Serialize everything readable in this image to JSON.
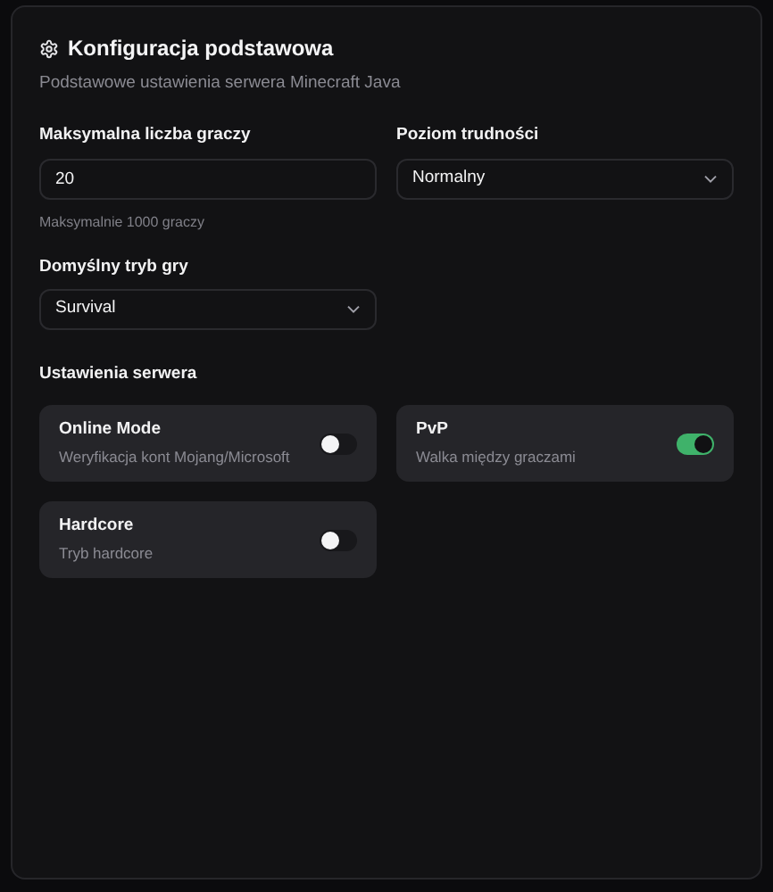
{
  "header": {
    "title": "Konfiguracja podstawowa",
    "subtitle": "Podstawowe ustawienia serwera Minecraft Java"
  },
  "fields": [
    {
      "kind": "input",
      "label": "Maksymalna liczba graczy",
      "value": "20",
      "help": "Maksymalnie 1000 graczy"
    },
    {
      "kind": "select",
      "label": "Poziom trudności",
      "value": "Normalny"
    },
    {
      "kind": "select",
      "label": "Domyślny tryb gry",
      "value": "Survival"
    }
  ],
  "server_settings": {
    "title": "Ustawienia serwera",
    "toggles": [
      {
        "label": "Online Mode",
        "description": "Weryfikacja kont Mojang/Microsoft",
        "on": false
      },
      {
        "label": "PvP",
        "description": "Walka między graczami",
        "on": true
      },
      {
        "label": "Hardcore",
        "description": "Tryb hardcore",
        "on": false
      }
    ]
  }
}
